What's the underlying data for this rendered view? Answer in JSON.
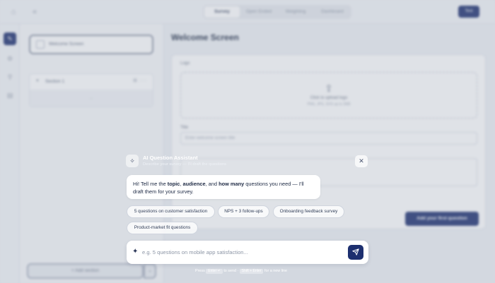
{
  "topbar": {
    "tabs": [
      "Survey",
      "Open Ended",
      "Weighting",
      "Dashboard"
    ],
    "active_tab": "Survey",
    "publish_label": "Test"
  },
  "sidebar": {
    "welcome_label": "Welcome Screen",
    "section_label": "Section 1",
    "section_placeholder": "...",
    "add_section_label": "+ Add section"
  },
  "main": {
    "title": "Welcome Screen",
    "logo_label": "Logo",
    "upload_text": "Click to upload logo",
    "upload_hint": "PNG, JPG, SVG up to 2MB",
    "title_label": "Title",
    "title_placeholder": "Enter welcome screen title",
    "add_first_question": "Add your first question"
  },
  "assistant": {
    "title": "AI Question Assistant",
    "subtitle": "Describe your survey — I'll draft the questions",
    "close_icon": "close-icon",
    "message": {
      "p1": "Hi! Tell me the ",
      "b1": "topic",
      "p2": ", ",
      "b2": "audience",
      "p3": ", and ",
      "b3": "how many",
      "p4": " questions you need — I'll draft them for your survey."
    },
    "suggestions": [
      "5 questions on customer satisfaction",
      "NPS + 3 follow-ups",
      "Onboarding feedback survey",
      "Product-market fit questions"
    ],
    "input_placeholder": "e.g. 5 questions on mobile app satisfaction...",
    "hint": {
      "press": "Press",
      "enter_key": "Enter ↵",
      "to_send": "to send ·",
      "shift_enter_key": "Shift + Enter",
      "new_line": "for a new line"
    }
  },
  "colors": {
    "primary": "#1d2f6f",
    "backdrop": "#eef1f5"
  }
}
